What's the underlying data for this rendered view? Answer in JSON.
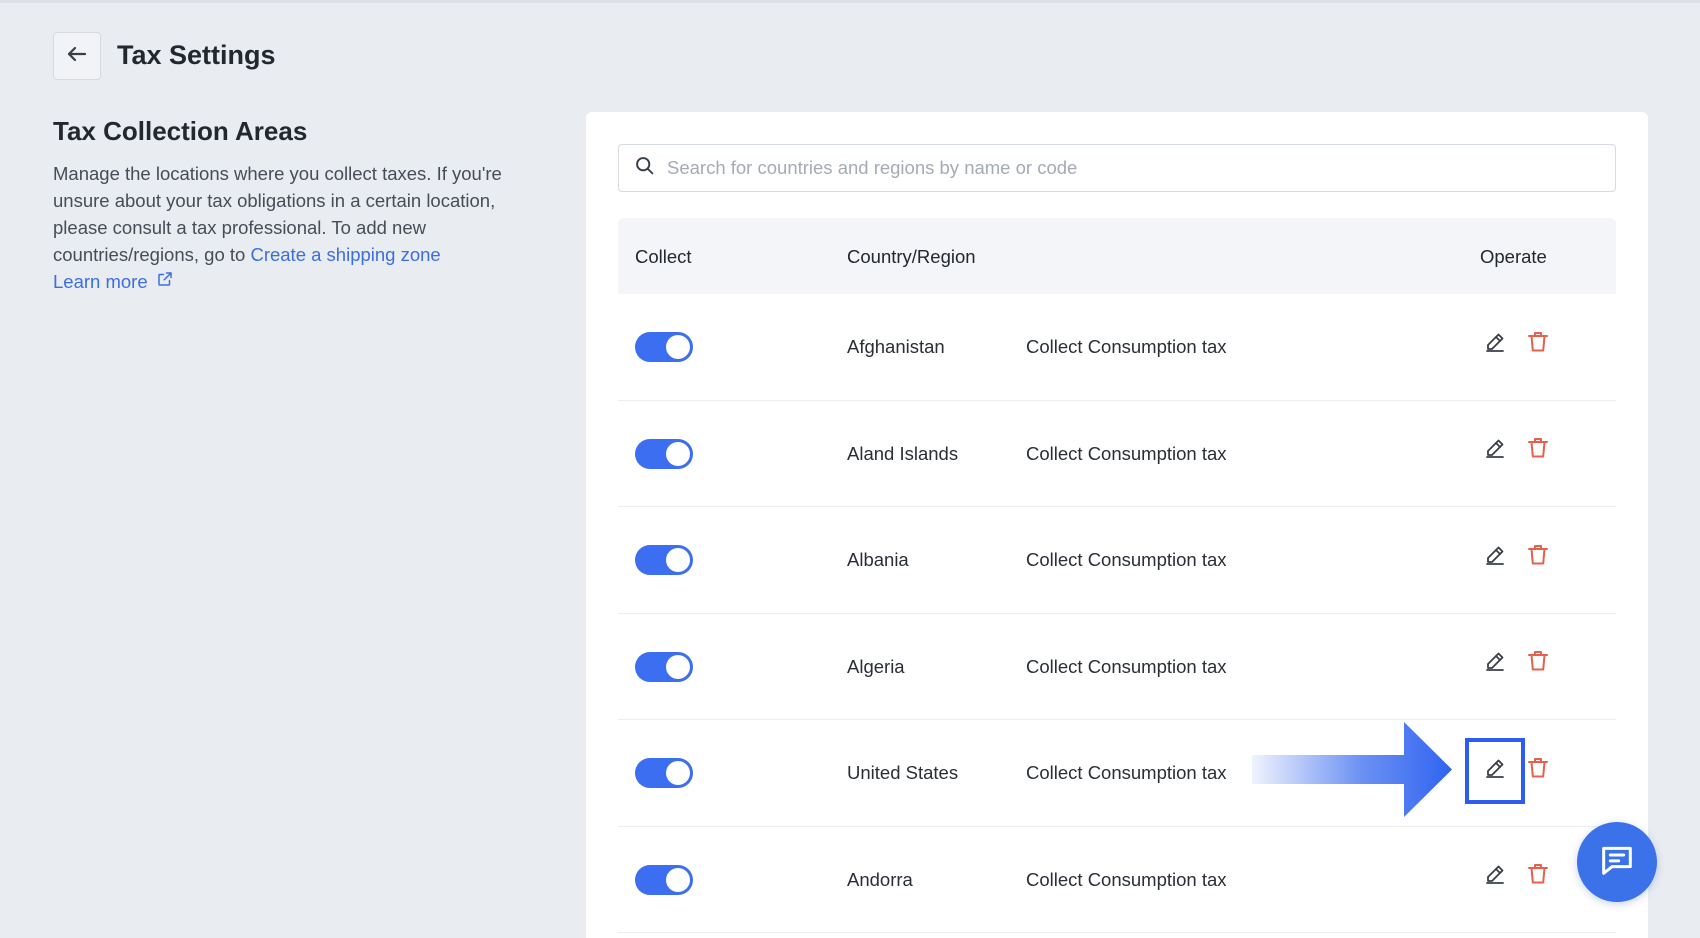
{
  "header": {
    "title": "Tax Settings"
  },
  "section": {
    "title": "Tax Collection Areas",
    "description": "Manage the locations where you collect taxes. If you're unsure about your tax obligations in a certain location, please consult a tax professional. To add new countries/regions, go to",
    "create_link": "Create a shipping zone",
    "learn_more": "Learn more"
  },
  "search": {
    "placeholder": "Search for countries and regions by name or code",
    "value": ""
  },
  "table": {
    "columns": {
      "collect": "Collect",
      "country": "Country/Region",
      "operate": "Operate"
    },
    "rows": [
      {
        "country": "Afghanistan",
        "tax": "Collect Consumption tax",
        "collect": true
      },
      {
        "country": "Aland Islands",
        "tax": "Collect Consumption tax",
        "collect": true
      },
      {
        "country": "Albania",
        "tax": "Collect Consumption tax",
        "collect": true
      },
      {
        "country": "Algeria",
        "tax": "Collect Consumption tax",
        "collect": true
      },
      {
        "country": "United States",
        "tax": "Collect Consumption tax",
        "collect": true
      },
      {
        "country": "Andorra",
        "tax": "Collect Consumption tax",
        "collect": true
      }
    ]
  },
  "icons": {
    "back": "arrow-left-icon",
    "search": "search-icon",
    "external": "external-link-icon",
    "edit": "pencil-icon",
    "delete": "trash-icon",
    "chat": "chat-icon"
  },
  "colors": {
    "accent": "#3b6ef0",
    "link": "#3c6ee0",
    "delete": "#e5604d",
    "highlight": "#2e5bf0"
  }
}
